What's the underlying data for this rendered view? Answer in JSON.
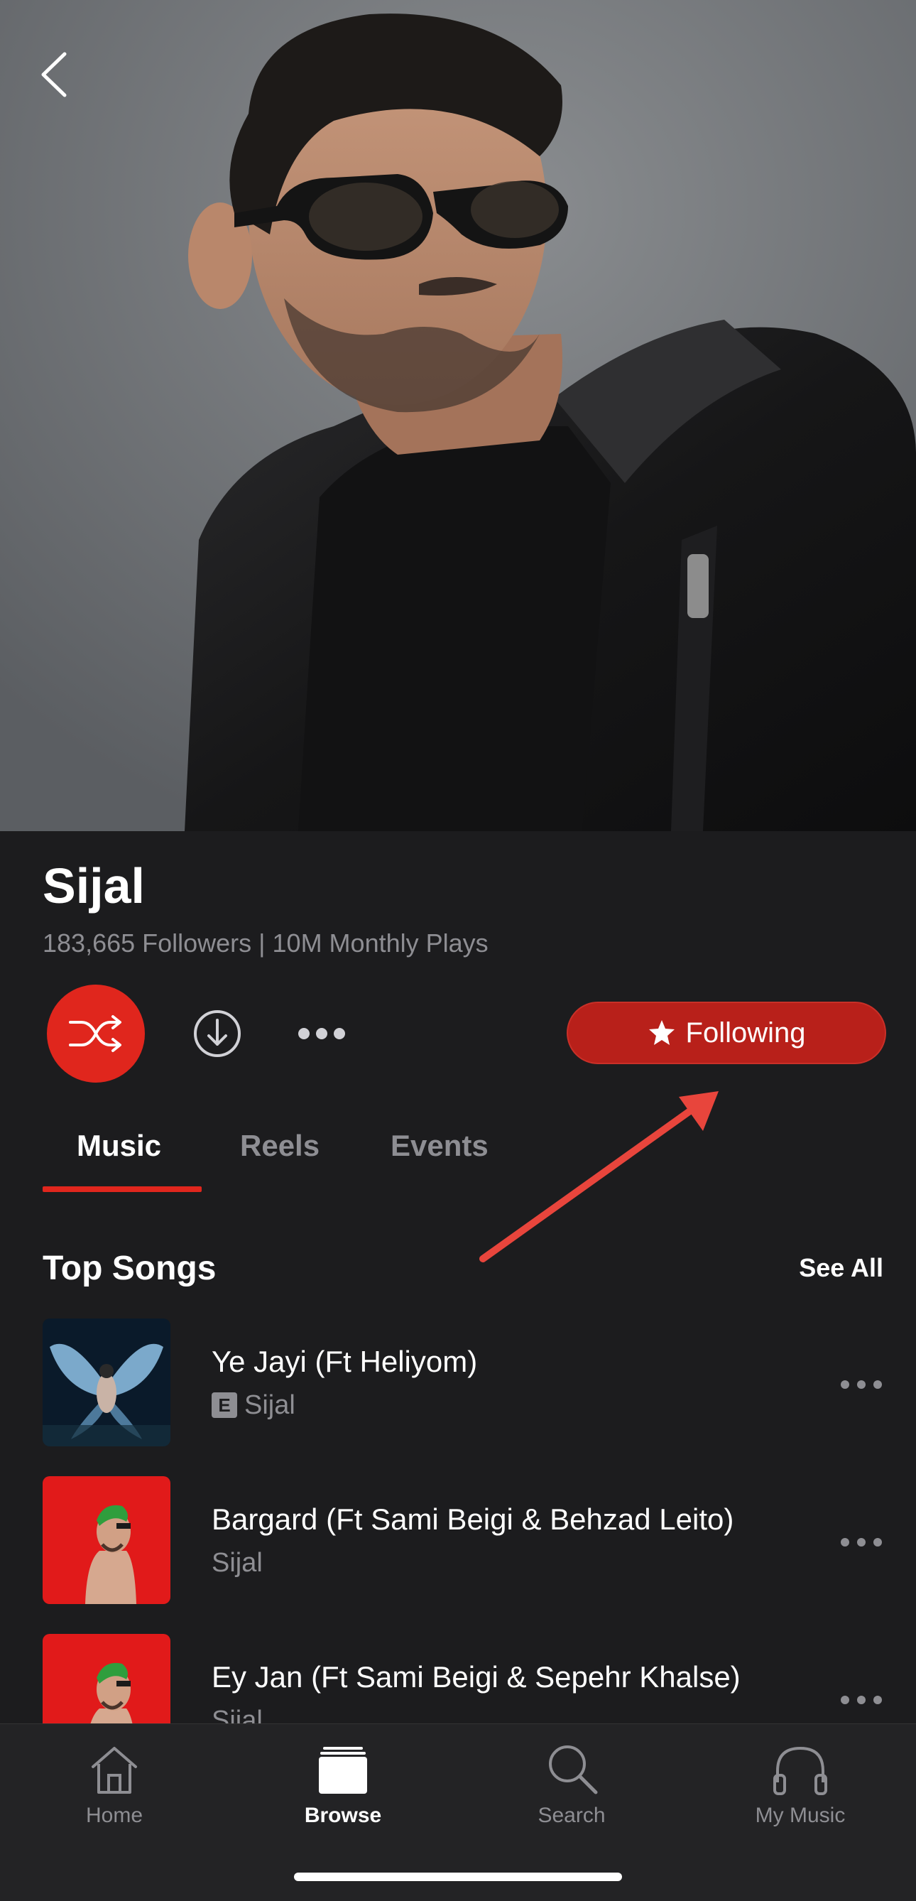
{
  "artist": {
    "name": "Sijal",
    "stats": "183,665 Followers | 10M Monthly Plays"
  },
  "actions": {
    "following_label": "Following"
  },
  "tabs": [
    {
      "label": "Music",
      "active": true
    },
    {
      "label": "Reels",
      "active": false
    },
    {
      "label": "Events",
      "active": false
    }
  ],
  "top_songs": {
    "title": "Top Songs",
    "see_all": "See All",
    "songs": [
      {
        "title": "Ye Jayi (Ft Heliyom)",
        "artist": "Sijal",
        "explicit_badge": "E"
      },
      {
        "title": "Bargard (Ft Sami Beigi & Behzad Leito)",
        "artist": "Sijal"
      },
      {
        "title": "Ey Jan (Ft Sami Beigi & Sepehr Khalse)",
        "artist": "Sijal"
      }
    ]
  },
  "tabbar": [
    {
      "label": "Home",
      "icon": "home-icon"
    },
    {
      "label": "Browse",
      "icon": "browse-icon",
      "active": true
    },
    {
      "label": "Search",
      "icon": "search-icon"
    },
    {
      "label": "My Music",
      "icon": "headphones-icon"
    }
  ],
  "colors": {
    "accent": "#e0261d",
    "following_button": "#b8201a",
    "background": "#1c1c1e",
    "secondary_text": "#8e8e93",
    "annotation_arrow": "#e8453c"
  }
}
